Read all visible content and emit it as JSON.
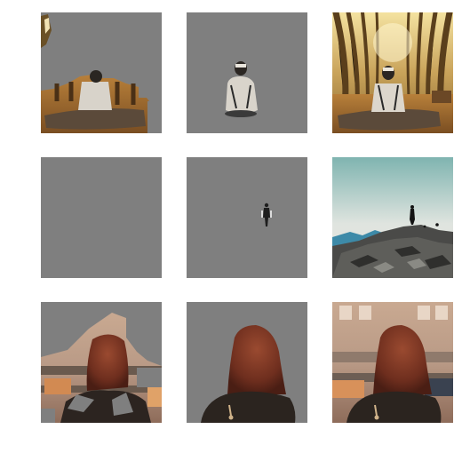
{
  "grid": {
    "rows": 3,
    "cols": 3,
    "mask_color": "#7f7f7f",
    "tiles": [
      {
        "row": 1,
        "col": 1,
        "scene": "forest-seated-person",
        "kind": "masked-context"
      },
      {
        "row": 1,
        "col": 2,
        "scene": "forest-seated-person",
        "kind": "masked-subject"
      },
      {
        "row": 1,
        "col": 3,
        "scene": "forest-seated-person",
        "kind": "original"
      },
      {
        "row": 2,
        "col": 1,
        "scene": "mountain-hiker",
        "kind": "masked-empty"
      },
      {
        "row": 2,
        "col": 2,
        "scene": "mountain-hiker",
        "kind": "masked-subject"
      },
      {
        "row": 2,
        "col": 3,
        "scene": "mountain-hiker",
        "kind": "original"
      },
      {
        "row": 3,
        "col": 1,
        "scene": "street-woman-back",
        "kind": "masked-context"
      },
      {
        "row": 3,
        "col": 2,
        "scene": "street-woman-back",
        "kind": "masked-subject"
      },
      {
        "row": 3,
        "col": 3,
        "scene": "street-woman-back",
        "kind": "original"
      }
    ]
  }
}
